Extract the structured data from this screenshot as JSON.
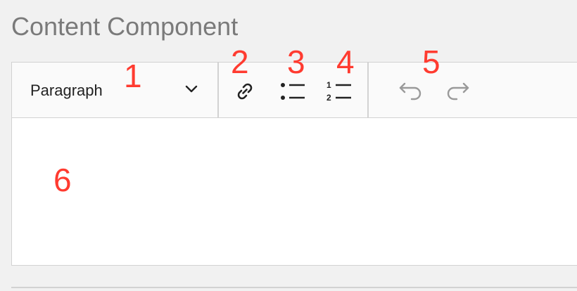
{
  "title": "Content Component",
  "toolbar": {
    "format_selected": "Paragraph",
    "tools": [
      {
        "name": "link",
        "icon": "link-icon"
      },
      {
        "name": "bulleted-list",
        "icon": "bulleted-list-icon"
      },
      {
        "name": "numbered-list",
        "icon": "numbered-list-icon"
      },
      {
        "name": "undo",
        "icon": "undo-icon"
      },
      {
        "name": "redo",
        "icon": "redo-icon"
      }
    ],
    "numbered_icon_digits": [
      "1",
      "2"
    ]
  },
  "editor": {
    "content": ""
  },
  "markers": [
    "1",
    "2",
    "3",
    "4",
    "5",
    "6"
  ],
  "colors": {
    "marker": "#ff3b30",
    "border": "#d2d2d2",
    "toolbar_bg": "#fafafa",
    "icon_active": "#222222",
    "icon_disabled": "#9a9a9a"
  }
}
